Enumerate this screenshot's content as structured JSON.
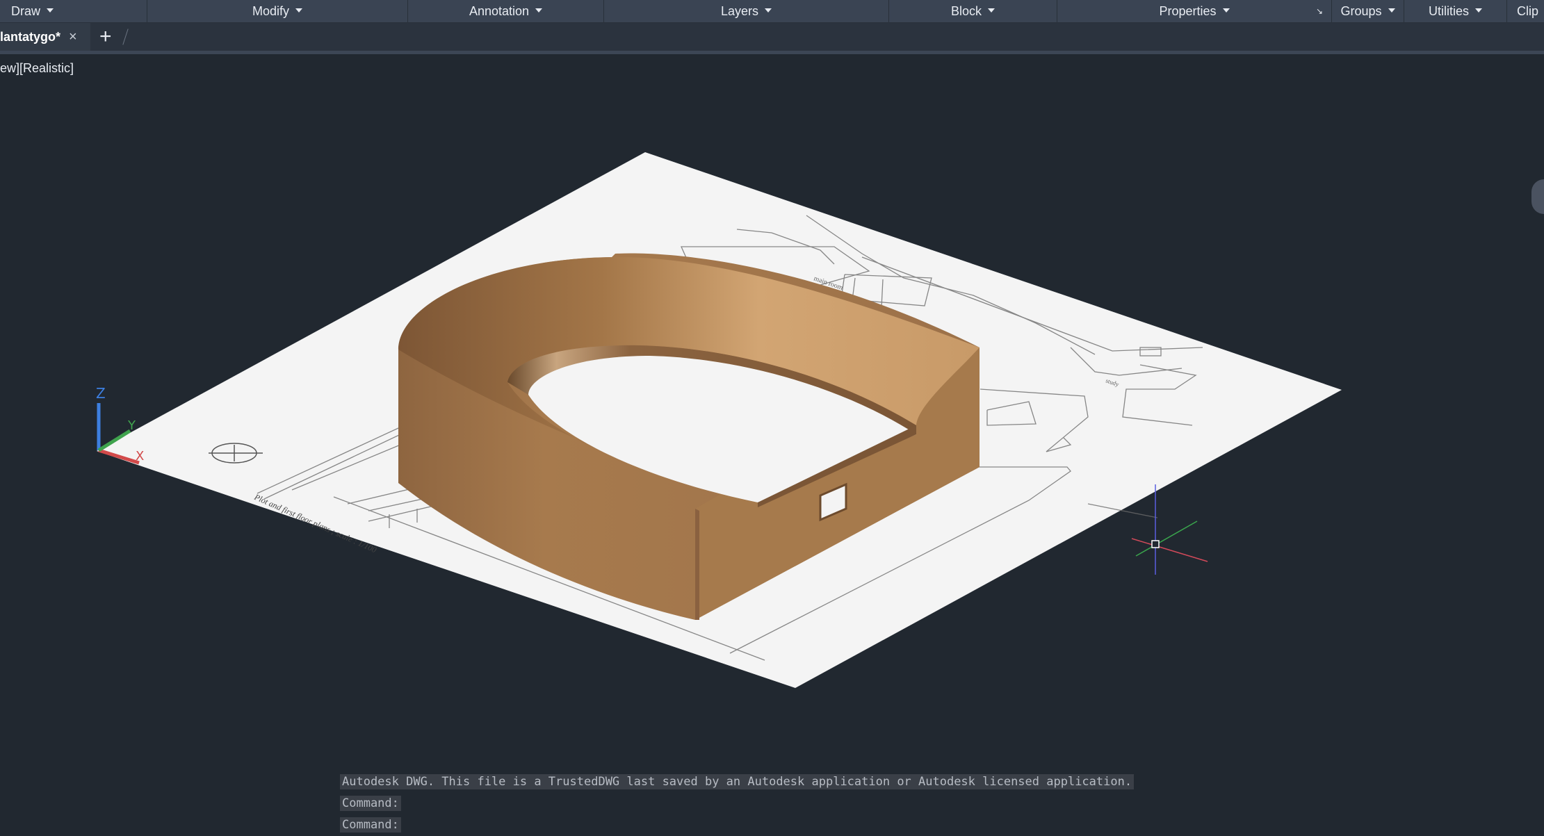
{
  "ribbon": {
    "panels": [
      {
        "label": "Draw"
      },
      {
        "label": "Modify"
      },
      {
        "label": "Annotation"
      },
      {
        "label": "Layers"
      },
      {
        "label": "Block"
      },
      {
        "label": "Properties"
      },
      {
        "label": "Groups"
      },
      {
        "label": "Utilities"
      },
      {
        "label": "Clip"
      }
    ]
  },
  "file_tab": {
    "name": "lantatygo*",
    "close_icon": "close-icon",
    "new_tab_icon": "plus-icon"
  },
  "viewport": {
    "label": "ew][Realistic]",
    "visual_style": "Realistic"
  },
  "ucs": {
    "x": "X",
    "y": "Y",
    "z": "Z"
  },
  "drawing": {
    "plan_caption": "Plot and first floor plans ; scale : 1/100",
    "room_labels": [
      "main room",
      "study"
    ]
  },
  "command_line": {
    "history": [
      "Autodesk DWG.  This file is a TrustedDWG last saved by an Autodesk application or Autodesk licensed application.",
      "Command:",
      "Command:"
    ]
  },
  "colors": {
    "background": "#212830",
    "ribbon": "#3a4453",
    "wall": "#b0804f",
    "sheet": "#f4f4f4"
  }
}
